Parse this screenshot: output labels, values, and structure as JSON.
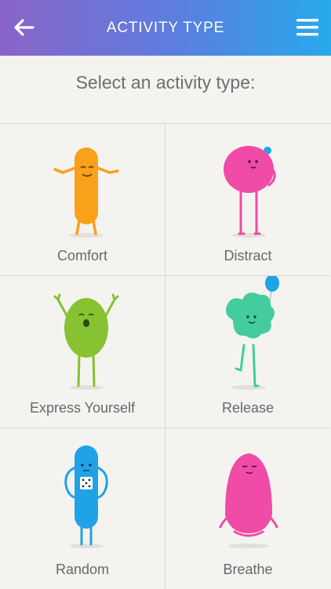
{
  "header": {
    "title": "ACTIVITY TYPE",
    "back_icon": "arrow-left-icon",
    "menu_icon": "hamburger-menu-icon",
    "gradient": [
      "#8a63c9",
      "#27a9ec"
    ]
  },
  "prompt": "Select an activity type:",
  "activities": [
    {
      "label": "Comfort",
      "color": "#f9a11b"
    },
    {
      "label": "Distract",
      "color": "#f04ba6"
    },
    {
      "label": "Express Yourself",
      "color": "#86c232"
    },
    {
      "label": "Release",
      "color": "#44cc9c"
    },
    {
      "label": "Random",
      "color": "#1fa3e6"
    },
    {
      "label": "Breathe",
      "color": "#f04ba6"
    }
  ]
}
